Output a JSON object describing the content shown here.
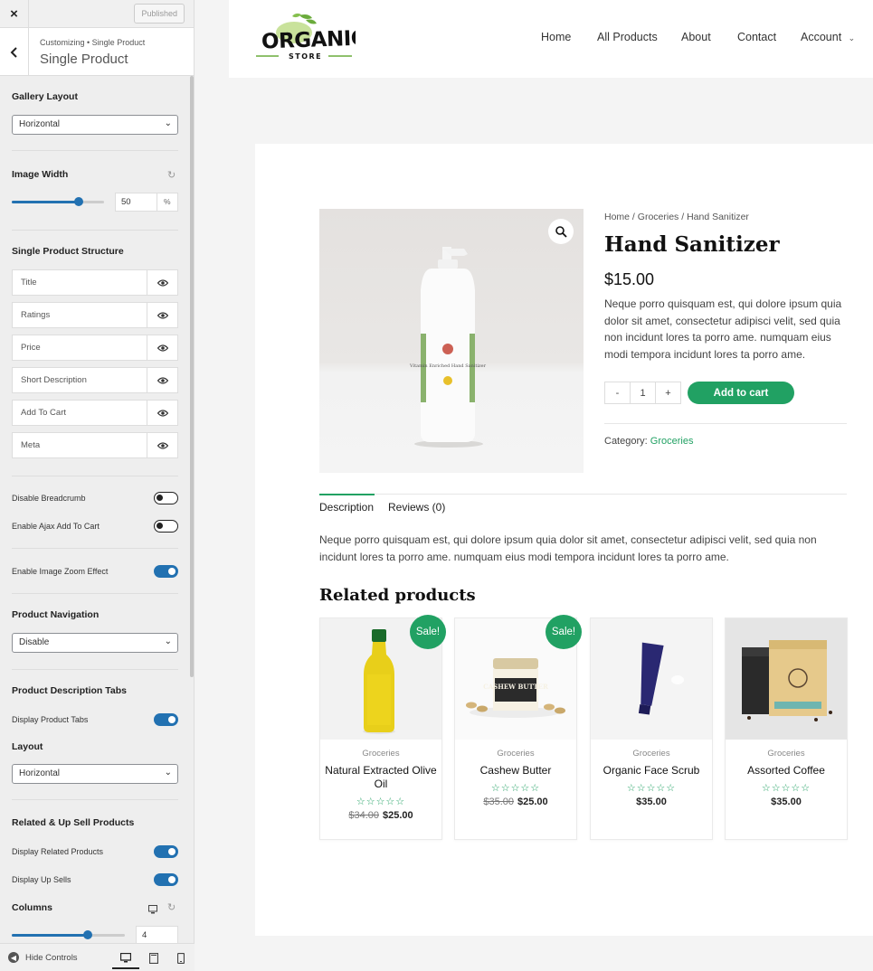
{
  "sidebar": {
    "close_icon": "×",
    "published_label": "Published",
    "crumb": "Customizing • Single Product",
    "title": "Single Product",
    "gallery_layout": {
      "label": "Gallery Layout",
      "value": "Horizontal"
    },
    "image_width": {
      "label": "Image Width",
      "value": "50",
      "unit": "%",
      "level_percent": 50
    },
    "structure": {
      "label": "Single Product Structure",
      "items": [
        "Title",
        "Ratings",
        "Price",
        "Short Description",
        "Add To Cart",
        "Meta"
      ]
    },
    "toggles": {
      "disable_breadcrumb": {
        "label": "Disable Breadcrumb",
        "on": false
      },
      "ajax_cart": {
        "label": "Enable Ajax Add To Cart",
        "on": false
      },
      "image_zoom": {
        "label": "Enable Image Zoom Effect",
        "on": true
      },
      "display_tabs": {
        "label": "Display Product Tabs",
        "on": true
      },
      "display_related": {
        "label": "Display Related Products",
        "on": true
      },
      "display_upsells": {
        "label": "Display Up Sells",
        "on": true
      }
    },
    "product_navigation": {
      "label": "Product Navigation",
      "value": "Disable"
    },
    "tabs_section": {
      "label": "Product Description Tabs",
      "layout_label": "Layout",
      "layout_value": "Horizontal"
    },
    "related_section": {
      "label": "Related & Up Sell Products",
      "columns_label": "Columns",
      "columns_value": "4"
    },
    "footer": {
      "hide_controls": "Hide Controls"
    }
  },
  "site": {
    "logo_text": "ORGANIC",
    "logo_sub": "STORE",
    "nav": [
      "Home",
      "All Products",
      "About",
      "Contact",
      "Account"
    ]
  },
  "product": {
    "breadcrumb": {
      "home": "Home",
      "sep1": " / ",
      "cat": "Groceries",
      "sep2": " / ",
      "current": "Hand Sanitizer"
    },
    "title": "Hand Sanitizer",
    "price": "$15.00",
    "short_description": "Neque porro quisquam est, qui dolore ipsum quia dolor sit amet, consectetur adipisci velit, sed quia non incidunt lores ta porro ame. numquam eius modi tempora incidunt lores ta porro ame.",
    "qty_minus": "-",
    "qty_value": "1",
    "qty_plus": "+",
    "add_to_cart": "Add to cart",
    "category_label": "Category:",
    "category": "Groceries",
    "bottle_label": "Vitamin Enriched Hand Sanitizer"
  },
  "tabs": {
    "description": "Description",
    "reviews": "Reviews (0)",
    "description_text": "Neque porro quisquam est, qui dolore ipsum quia dolor sit amet, consectetur adipisci velit, sed quia non incidunt lores ta porro ame. numquam eius modi tempora incidunt lores ta porro ame."
  },
  "related": {
    "heading": "Related products",
    "sale_badge": "Sale!",
    "items": [
      {
        "category": "Groceries",
        "name": "Natural Extracted Olive Oil",
        "old_price": "$34.00",
        "price": "$25.00",
        "sale": true
      },
      {
        "category": "Groceries",
        "name": "Cashew Butter",
        "old_price": "$35.00",
        "price": "$25.00",
        "sale": true,
        "jar_text": "CASHEW BUTTER"
      },
      {
        "category": "Groceries",
        "name": "Organic Face Scrub",
        "old_price": "",
        "price": "$35.00",
        "sale": false
      },
      {
        "category": "Groceries",
        "name": "Assorted Coffee",
        "old_price": "",
        "price": "$35.00",
        "sale": false
      }
    ]
  },
  "colors": {
    "accent": "#21a163",
    "toggle_blue": "#2271b1"
  },
  "icons": {
    "stars": "☆☆☆☆☆"
  }
}
